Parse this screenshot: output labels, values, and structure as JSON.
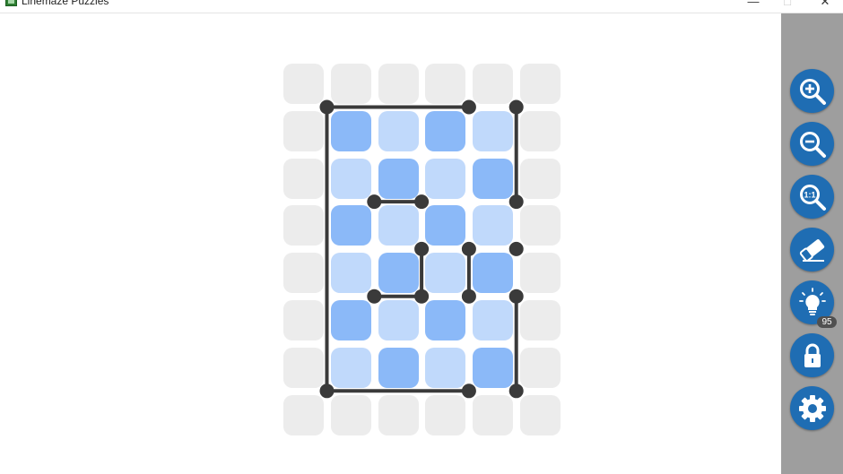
{
  "window": {
    "title": "Linemaze Puzzles",
    "controls": {
      "minimize": "—",
      "maximize": "□",
      "close": "✕"
    }
  },
  "colors": {
    "cell_outside": "#ececec",
    "cell_dark": "#8bb9f8",
    "cell_light": "#c0d9fb",
    "line": "#3a3a3a",
    "sidebar": "#9e9e9e",
    "tool_button": "#1f6db3"
  },
  "puzzle": {
    "grid": [
      [
        "out",
        "out",
        "out",
        "out",
        "out",
        "out"
      ],
      [
        "out",
        "dark",
        "light",
        "dark",
        "light",
        "out"
      ],
      [
        "out",
        "light",
        "dark",
        "light",
        "dark",
        "out"
      ],
      [
        "out",
        "dark",
        "light",
        "dark",
        "light",
        "out"
      ],
      [
        "out",
        "light",
        "dark",
        "light",
        "dark",
        "out"
      ],
      [
        "out",
        "dark",
        "light",
        "dark",
        "light",
        "out"
      ],
      [
        "out",
        "light",
        "dark",
        "light",
        "dark",
        "out"
      ],
      [
        "out",
        "out",
        "out",
        "out",
        "out",
        "out"
      ]
    ],
    "segments": [
      [
        [
          1,
          1
        ],
        [
          4,
          1
        ]
      ],
      [
        [
          1,
          1
        ],
        [
          1,
          7
        ]
      ],
      [
        [
          1,
          7
        ],
        [
          4,
          7
        ]
      ],
      [
        [
          5,
          1
        ],
        [
          5,
          3
        ]
      ],
      [
        [
          2,
          3
        ],
        [
          3,
          3
        ]
      ],
      [
        [
          3,
          4
        ],
        [
          3,
          5
        ]
      ],
      [
        [
          2,
          5
        ],
        [
          3,
          5
        ]
      ],
      [
        [
          4,
          4
        ],
        [
          4,
          5
        ]
      ],
      [
        [
          5,
          5
        ],
        [
          5,
          7
        ]
      ]
    ],
    "nodes": [
      [
        1,
        1
      ],
      [
        4,
        1
      ],
      [
        5,
        1
      ],
      [
        2,
        3
      ],
      [
        3,
        3
      ],
      [
        5,
        3
      ],
      [
        3,
        4
      ],
      [
        4,
        4
      ],
      [
        5,
        4
      ],
      [
        2,
        5
      ],
      [
        3,
        5
      ],
      [
        4,
        5
      ],
      [
        5,
        5
      ],
      [
        1,
        7
      ],
      [
        4,
        7
      ],
      [
        5,
        7
      ]
    ]
  },
  "toolbar": [
    {
      "name": "zoom-in",
      "icon": "zoom-in-icon"
    },
    {
      "name": "zoom-out",
      "icon": "zoom-out-icon"
    },
    {
      "name": "zoom-reset",
      "icon": "zoom-reset-icon",
      "label": "1:1"
    },
    {
      "name": "eraser",
      "icon": "eraser-icon"
    },
    {
      "name": "hint",
      "icon": "lightbulb-icon",
      "badge": "95"
    },
    {
      "name": "lock",
      "icon": "lock-icon"
    },
    {
      "name": "settings",
      "icon": "gear-icon"
    }
  ]
}
